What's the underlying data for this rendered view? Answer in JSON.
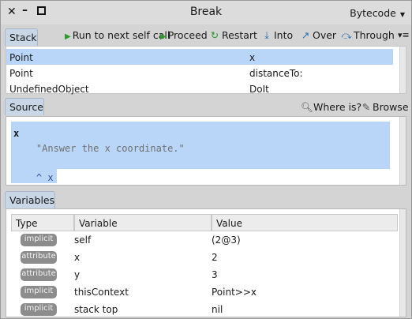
{
  "window": {
    "title": "Break",
    "mode": "Bytecode"
  },
  "stack": {
    "tab_label": "Stack",
    "toolbar": [
      {
        "label": "Run to next self call",
        "icon": "run-triangle-icon"
      },
      {
        "label": "Proceed",
        "icon": "proceed-triangle-icon"
      },
      {
        "label": "Restart",
        "icon": "restart-icon"
      },
      {
        "label": "Into",
        "icon": "step-into-icon"
      },
      {
        "label": "Over",
        "icon": "step-over-icon"
      },
      {
        "label": "Through",
        "icon": "step-through-icon"
      }
    ],
    "rows": [
      {
        "receiver": "Point",
        "selector": "x",
        "selected": true
      },
      {
        "receiver": "Point",
        "selector": "distanceTo:",
        "selected": false
      },
      {
        "receiver": "UndefinedObject",
        "selector": "DoIt",
        "selected": false
      }
    ]
  },
  "source": {
    "tab_label": "Source",
    "where_is_label": "Where is?",
    "browse_label": "Browse",
    "code_lines": [
      "x",
      "    \"Answer the x coordinate.\"",
      "",
      "    ^ x"
    ]
  },
  "variables": {
    "tab_label": "Variables",
    "columns": [
      "Type",
      "Variable",
      "Value"
    ],
    "rows": [
      {
        "type": "implicit",
        "variable": "self",
        "value": "(2@3)"
      },
      {
        "type": "attribute",
        "variable": "x",
        "value": "2"
      },
      {
        "type": "attribute",
        "variable": "y",
        "value": "3"
      },
      {
        "type": "implicit",
        "variable": "thisContext",
        "value": "Point>>x"
      },
      {
        "type": "implicit",
        "variable": "stack top",
        "value": "nil"
      }
    ]
  },
  "colors": {
    "selection": "#b9d6f8",
    "tab": "#c8d6e6",
    "badge": "#8c8c8c",
    "run_green": "#2e9a2e"
  }
}
